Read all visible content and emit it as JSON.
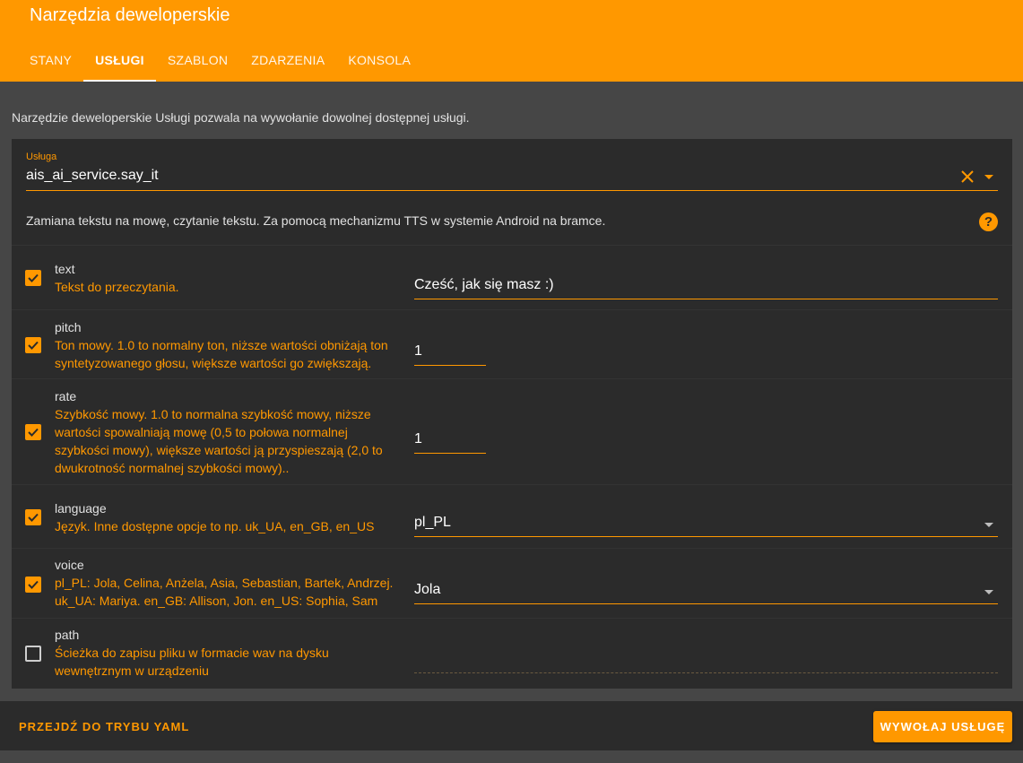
{
  "header": {
    "title": "Narzędzia deweloperskie",
    "tabs": [
      {
        "label": "STANY"
      },
      {
        "label": "USŁUGI"
      },
      {
        "label": "SZABLON"
      },
      {
        "label": "ZDARZENIA"
      },
      {
        "label": "KONSOLA"
      }
    ],
    "active_tab": "USŁUGI"
  },
  "intro": "Narzędzie deweloperskie Usługi pozwala na wywołanie dowolnej dostępnej usługi.",
  "service": {
    "label": "Usługa",
    "value": "ais_ai_service.say_it",
    "description": "Zamiana tekstu na mowę, czytanie tekstu. Za pomocą mechanizmu TTS w systemie Android na bramce."
  },
  "params": [
    {
      "name": "text",
      "description": "Tekst do przeczytania.",
      "value": "Cześć, jak się masz :)",
      "checked": true
    },
    {
      "name": "pitch",
      "description": "Ton mowy. 1.0 to normalny ton, niższe wartości obniżają ton syntetyzowanego głosu, większe wartości go zwiększają.",
      "value": "1",
      "checked": true
    },
    {
      "name": "rate",
      "description": "Szybkość mowy. 1.0 to normalna szybkość mowy, niższe wartości spowalniają mowę (0,5 to połowa normalnej szybkości mowy), większe wartości ją przyspieszają (2,0 to dwukrotność normalnej szybkości mowy)..",
      "value": "1",
      "checked": true
    },
    {
      "name": "language",
      "description": "Język. Inne dostępne opcje to np. uk_UA, en_GB, en_US",
      "value": "pl_PL",
      "checked": true
    },
    {
      "name": "voice",
      "description": "pl_PL: Jola, Celina, Anżela, Asia, Sebastian, Bartek, Andrzej. uk_UA: Mariya. en_GB: Allison, Jon. en_US: Sophia, Sam",
      "value": "Jola",
      "checked": true
    },
    {
      "name": "path",
      "description": "Ścieżka do zapisu pliku w formacie wav na dysku wewnętrznym w urządzeniu",
      "value": "",
      "checked": false
    }
  ],
  "footer": {
    "yaml_label": "PRZEJDŹ DO TRYBU YAML",
    "call_label": "WYWOŁAJ USŁUGĘ"
  },
  "colors": {
    "accent": "#ff9800",
    "background": "#464646",
    "card": "#2b2b2b"
  }
}
